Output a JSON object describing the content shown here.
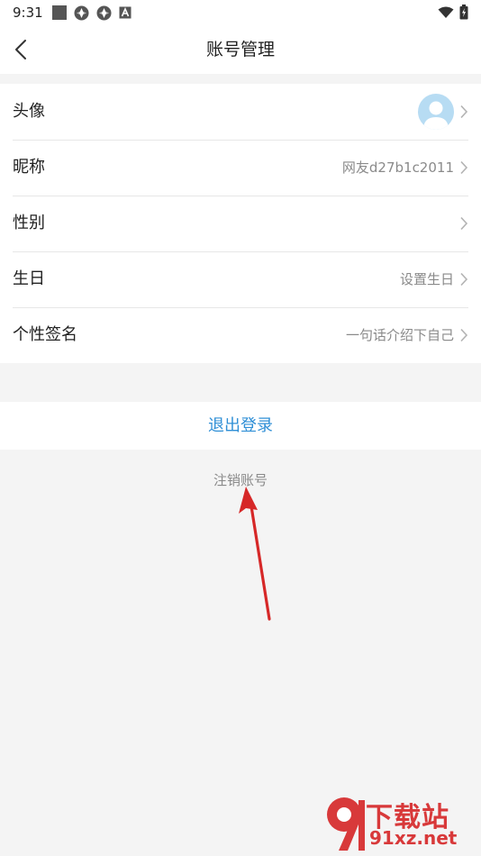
{
  "status_bar": {
    "time": "9:31",
    "left_icons": [
      "square-icon",
      "aperture-icon",
      "aperture-icon",
      "a-icon"
    ],
    "right_icons": [
      "wifi-icon",
      "battery-icon"
    ]
  },
  "header": {
    "title": "账号管理",
    "back_icon": "chevron-left-icon"
  },
  "settings": {
    "items": [
      {
        "label": "头像",
        "value": "",
        "icon": "avatar"
      },
      {
        "label": "昵称",
        "value": "网友d27b1c2011"
      },
      {
        "label": "性别",
        "value": ""
      },
      {
        "label": "生日",
        "value": "设置生日"
      },
      {
        "label": "个性签名",
        "value": "一句话介绍下自己"
      }
    ]
  },
  "logout": {
    "label": "退出登录"
  },
  "cancel_account": {
    "label": "注销账号"
  },
  "watermark": {
    "top": "下载站",
    "bottom": "91xz.net"
  },
  "colors": {
    "accent": "#2f8fd6",
    "background": "#f4f4f4",
    "arrow": "#d62828",
    "watermark": "#d8393a"
  }
}
